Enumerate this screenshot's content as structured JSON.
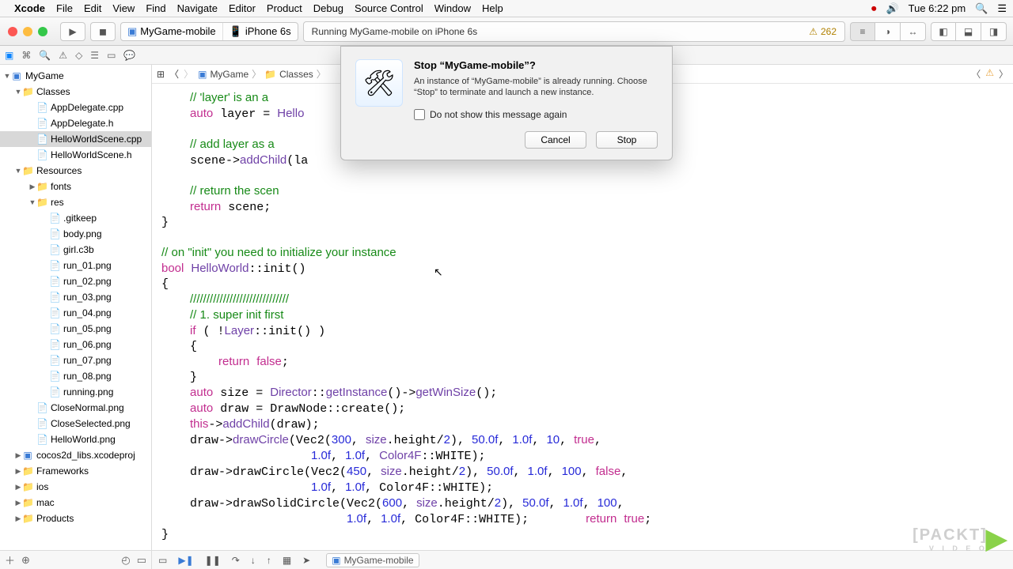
{
  "menubar": {
    "app": "Xcode",
    "items": [
      "File",
      "Edit",
      "View",
      "Find",
      "Navigate",
      "Editor",
      "Product",
      "Debug",
      "Source Control",
      "Window",
      "Help"
    ],
    "clock": "Tue 6:22 pm"
  },
  "toolbar": {
    "scheme_target": "MyGame-mobile",
    "scheme_device": "iPhone 6s",
    "status_text": "Running MyGame-mobile on iPhone 6s",
    "warning_count": "262"
  },
  "jumpbar": {
    "crumbs": [
      "MyGame",
      "Classes"
    ]
  },
  "navigator": {
    "project": "MyGame",
    "groups": {
      "classes": "Classes",
      "classes_items": [
        "AppDelegate.cpp",
        "AppDelegate.h",
        "HelloWorldScene.cpp",
        "HelloWorldScene.h"
      ],
      "resources": "Resources",
      "fonts": "fonts",
      "res": "res",
      "res_items": [
        ".gitkeep",
        "body.png",
        "girl.c3b",
        "run_01.png",
        "run_02.png",
        "run_03.png",
        "run_04.png",
        "run_05.png",
        "run_06.png",
        "run_07.png",
        "run_08.png",
        "running.png"
      ],
      "res_siblings": [
        "CloseNormal.png",
        "CloseSelected.png",
        "HelloWorld.png"
      ],
      "bottom": [
        "cocos2d_libs.xcodeproj",
        "Frameworks",
        "ios",
        "mac",
        "Products"
      ]
    }
  },
  "dialog": {
    "title": "Stop “MyGame-mobile”?",
    "body": "An instance of “MyGame-mobile” is already running. Choose “Stop” to terminate and launch a new instance.",
    "checkbox": "Do not show this message again",
    "cancel": "Cancel",
    "stop": "Stop"
  },
  "debugbar": {
    "process": "MyGame-mobile"
  },
  "watermark": {
    "text": "[PACKT]",
    "sub": "V I D E O"
  },
  "code_lines": [
    {
      "i": "    ",
      "t": [
        {
          "c": "cc",
          "x": "// 'layer' is an a"
        }
      ]
    },
    {
      "i": "    ",
      "t": [
        {
          "c": "ck",
          "x": "auto"
        },
        {
          "x": " layer = "
        },
        {
          "c": "ct",
          "x": "Hello"
        }
      ]
    },
    {
      "i": "",
      "t": []
    },
    {
      "i": "    ",
      "t": [
        {
          "c": "cc",
          "x": "// add layer as a "
        }
      ]
    },
    {
      "i": "    ",
      "t": [
        {
          "x": "scene->"
        },
        {
          "c": "ct",
          "x": "addChild"
        },
        {
          "x": "(la"
        }
      ]
    },
    {
      "i": "",
      "t": []
    },
    {
      "i": "    ",
      "t": [
        {
          "c": "cc",
          "x": "// return the scen"
        }
      ]
    },
    {
      "i": "    ",
      "t": [
        {
          "c": "ck",
          "x": "return"
        },
        {
          "x": " scene;"
        }
      ]
    },
    {
      "i": "",
      "t": [
        {
          "x": "}"
        }
      ]
    },
    {
      "i": "",
      "t": []
    },
    {
      "i": "",
      "t": [
        {
          "c": "cc",
          "x": "// on \"init\" you need to initialize your instance"
        }
      ]
    },
    {
      "i": "",
      "t": [
        {
          "c": "ck",
          "x": "bool"
        },
        {
          "x": " "
        },
        {
          "c": "ct",
          "x": "HelloWorld"
        },
        {
          "x": "::init()"
        }
      ]
    },
    {
      "i": "",
      "t": [
        {
          "x": "{"
        }
      ]
    },
    {
      "i": "    ",
      "t": [
        {
          "c": "cc",
          "x": "//////////////////////////////"
        }
      ]
    },
    {
      "i": "    ",
      "t": [
        {
          "c": "cc",
          "x": "// 1. super init first"
        }
      ]
    },
    {
      "i": "    ",
      "t": [
        {
          "c": "ck",
          "x": "if"
        },
        {
          "x": " ( !"
        },
        {
          "c": "ct",
          "x": "Layer"
        },
        {
          "x": "::init() )"
        }
      ]
    },
    {
      "i": "    ",
      "t": [
        {
          "x": "{"
        }
      ]
    },
    {
      "i": "        ",
      "t": [
        {
          "c": "ck",
          "x": "return"
        },
        {
          "x": " "
        },
        {
          "c": "ck",
          "x": "false"
        },
        {
          "x": ";"
        }
      ]
    },
    {
      "i": "    ",
      "t": [
        {
          "x": "}"
        }
      ]
    },
    {
      "i": "    ",
      "t": [
        {
          "c": "ck",
          "x": "auto"
        },
        {
          "x": " size = "
        },
        {
          "c": "ct",
          "x": "Director"
        },
        {
          "x": "::"
        },
        {
          "c": "ct",
          "x": "getInstance"
        },
        {
          "x": "()->"
        },
        {
          "c": "ct",
          "x": "getWinSize"
        },
        {
          "x": "();"
        }
      ]
    },
    {
      "i": "    ",
      "t": [
        {
          "c": "ck",
          "x": "auto"
        },
        {
          "x": " draw = DrawNode::create();"
        }
      ]
    },
    {
      "i": "    ",
      "t": [
        {
          "c": "ck",
          "x": "this"
        },
        {
          "x": "->"
        },
        {
          "c": "ct",
          "x": "addChild"
        },
        {
          "x": "(draw);"
        }
      ]
    },
    {
      "i": "    ",
      "t": [
        {
          "x": "draw->"
        },
        {
          "c": "ct",
          "x": "drawCircle"
        },
        {
          "x": "(Vec2("
        },
        {
          "c": "cn",
          "x": "300"
        },
        {
          "x": ", "
        },
        {
          "c": "ct",
          "x": "size"
        },
        {
          "x": ".height/"
        },
        {
          "c": "cn",
          "x": "2"
        },
        {
          "x": "), "
        },
        {
          "c": "cn",
          "x": "50.0f"
        },
        {
          "x": ", "
        },
        {
          "c": "cn",
          "x": "1.0f"
        },
        {
          "x": ", "
        },
        {
          "c": "cn",
          "x": "10"
        },
        {
          "x": ", "
        },
        {
          "c": "ck",
          "x": "true"
        },
        {
          "x": ","
        }
      ]
    },
    {
      "i": "                     ",
      "t": [
        {
          "c": "cn",
          "x": "1.0f"
        },
        {
          "x": ", "
        },
        {
          "c": "cn",
          "x": "1.0f"
        },
        {
          "x": ", "
        },
        {
          "c": "ct",
          "x": "Color4F"
        },
        {
          "x": "::WHITE);"
        }
      ]
    },
    {
      "i": "    ",
      "t": [
        {
          "x": "draw->drawCircle(Vec2("
        },
        {
          "c": "cn",
          "x": "450"
        },
        {
          "x": ", "
        },
        {
          "c": "ct",
          "x": "size"
        },
        {
          "x": ".height/"
        },
        {
          "c": "cn",
          "x": "2"
        },
        {
          "x": "), "
        },
        {
          "c": "cn",
          "x": "50.0f"
        },
        {
          "x": ", "
        },
        {
          "c": "cn",
          "x": "1.0f"
        },
        {
          "x": ", "
        },
        {
          "c": "cn",
          "x": "100"
        },
        {
          "x": ", "
        },
        {
          "c": "ck",
          "x": "false"
        },
        {
          "x": ","
        }
      ]
    },
    {
      "i": "                     ",
      "t": [
        {
          "c": "cn",
          "x": "1.0f"
        },
        {
          "x": ", "
        },
        {
          "c": "cn",
          "x": "1.0f"
        },
        {
          "x": ", Color4F::WHITE);"
        }
      ]
    },
    {
      "i": "    ",
      "t": [
        {
          "x": "draw->drawSolidCircle(Vec2("
        },
        {
          "c": "cn",
          "x": "600"
        },
        {
          "x": ", "
        },
        {
          "c": "ct",
          "x": "size"
        },
        {
          "x": ".height/"
        },
        {
          "c": "cn",
          "x": "2"
        },
        {
          "x": "), "
        },
        {
          "c": "cn",
          "x": "50.0f"
        },
        {
          "x": ", "
        },
        {
          "c": "cn",
          "x": "1.0f"
        },
        {
          "x": ", "
        },
        {
          "c": "cn",
          "x": "100"
        },
        {
          "x": ","
        }
      ]
    },
    {
      "i": "                          ",
      "t": [
        {
          "c": "cn",
          "x": "1.0f"
        },
        {
          "x": ", "
        },
        {
          "c": "cn",
          "x": "1.0f"
        },
        {
          "x": ", Color4F::WHITE);        "
        },
        {
          "c": "ck",
          "x": "return"
        },
        {
          "x": " "
        },
        {
          "c": "ck",
          "x": "true"
        },
        {
          "x": ";"
        }
      ]
    },
    {
      "i": "",
      "t": [
        {
          "x": "}"
        }
      ]
    }
  ]
}
